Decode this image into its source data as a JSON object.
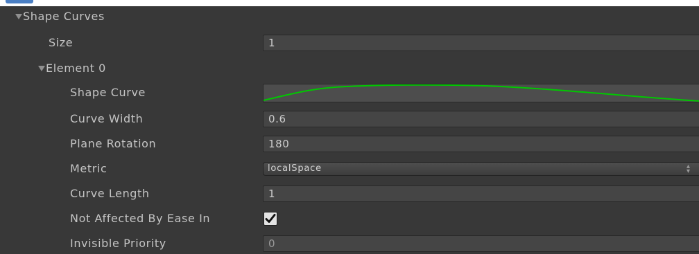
{
  "section": {
    "title": "Shape Curves"
  },
  "size": {
    "label": "Size",
    "value": "1"
  },
  "element": {
    "title": "Element 0"
  },
  "fields": {
    "shape_curve": {
      "label": "Shape Curve",
      "curve_color": "#00c800"
    },
    "curve_width": {
      "label": "Curve Width",
      "value": "0.6"
    },
    "plane_rotation": {
      "label": "Plane Rotation",
      "value": "180"
    },
    "metric": {
      "label": "Metric",
      "value": "localSpace"
    },
    "curve_length": {
      "label": "Curve Length",
      "value": "1"
    },
    "not_affected": {
      "label": "Not Affected By Ease In",
      "checked": true
    },
    "invisible_priority": {
      "label": "Invisible Priority",
      "value": "0"
    }
  },
  "colors": {
    "panel_bg": "#383838",
    "field_bg": "#454545",
    "text": "#c4c4c4",
    "curve": "#00c800"
  }
}
